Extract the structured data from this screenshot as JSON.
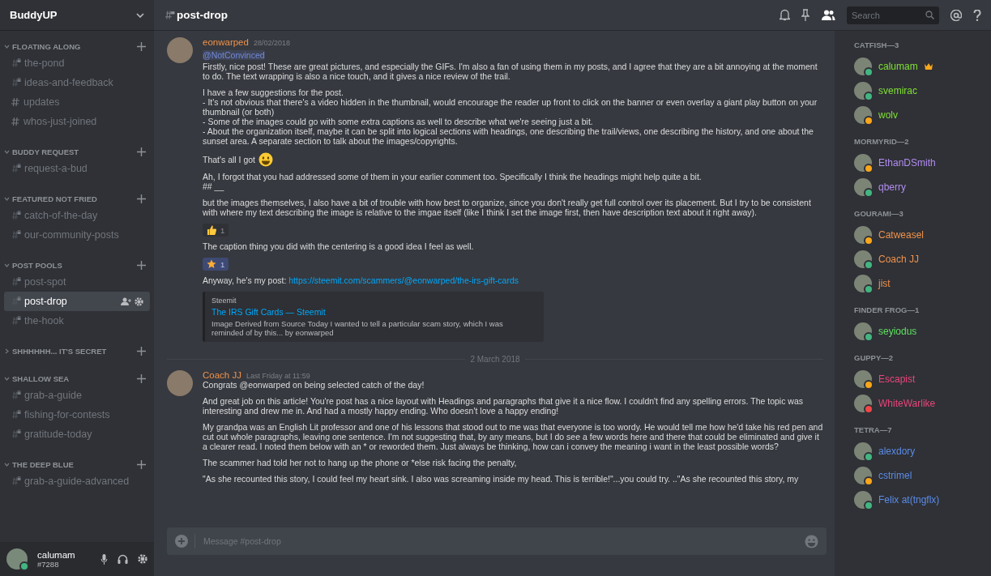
{
  "server": {
    "name": "BuddyUP"
  },
  "categories": [
    {
      "name": "FLOATING ALONG",
      "expanded": true,
      "channels": [
        {
          "name": "the-pond",
          "kind": "locked",
          "selected": false
        },
        {
          "name": "ideas-and-feedback",
          "kind": "locked",
          "selected": false
        },
        {
          "name": "updates",
          "kind": "public",
          "selected": false
        },
        {
          "name": "whos-just-joined",
          "kind": "public",
          "selected": false
        }
      ]
    },
    {
      "name": "BUDDY REQUEST",
      "expanded": true,
      "channels": [
        {
          "name": "request-a-bud",
          "kind": "locked",
          "selected": false
        }
      ]
    },
    {
      "name": "FEATURED NOT FRIED",
      "expanded": true,
      "channels": [
        {
          "name": "catch-of-the-day",
          "kind": "locked",
          "selected": false
        },
        {
          "name": "our-community-posts",
          "kind": "locked",
          "selected": false
        }
      ]
    },
    {
      "name": "POST POOLS",
      "expanded": true,
      "channels": [
        {
          "name": "post-spot",
          "kind": "locked",
          "selected": false
        },
        {
          "name": "post-drop",
          "kind": "locked",
          "selected": true
        },
        {
          "name": "the-hook",
          "kind": "locked",
          "selected": false
        }
      ]
    },
    {
      "name": "SHHHHHH... IT'S SECRET",
      "expanded": false
    },
    {
      "name": "SHALLOW SEA",
      "expanded": true,
      "channels": [
        {
          "name": "grab-a-guide",
          "kind": "locked",
          "selected": false
        },
        {
          "name": "fishing-for-contests",
          "kind": "locked",
          "selected": false
        },
        {
          "name": "gratitude-today",
          "kind": "locked",
          "selected": false
        }
      ]
    },
    {
      "name": "THE DEEP BLUE",
      "expanded": true,
      "channels": [
        {
          "name": "grab-a-guide-advanced",
          "kind": "locked",
          "selected": false
        }
      ]
    }
  ],
  "user": {
    "name": "calumam",
    "tag": "#7288"
  },
  "header": {
    "channel": "post-drop",
    "search": {
      "placeholder": "Search"
    }
  },
  "messages": [
    {
      "author": "eonwarped",
      "time": "28/02/2018",
      "blocks": [
        {
          "kind": "mention",
          "text": "@NotConvinced"
        },
        {
          "kind": "text",
          "text": "Firstly, nice post!  These are great pictures, and especially the GIFs. I'm also a fan of using them in my posts, and I agree that they are a bit annoying at the moment to do. The text wrapping is also a nice touch, and it gives a nice review of the trail."
        },
        {
          "kind": "text",
          "text": "I have a few suggestions for the post.\n- It's not obvious that there's a video hidden in the thumbnail, would encourage the reader up front to click on the banner or even overlay a giant play button on your thumbnail (or both)\n- Some of the images could go with some extra captions as well to describe what we're seeing just a bit.\n-  About the organization itself, maybe it can be split into logical sections with headings, one describing the trail/views,  one describing the history,  and one about the sunset area. A separate section to talk about the images/copyrights."
        },
        {
          "kind": "emoji_text",
          "text": "That's all I got"
        },
        {
          "kind": "text",
          "text": "Ah, I forgot that you had addressed some of them in your earlier comment too.  Specifically I think the headings might help quite a bit.\n## __"
        },
        {
          "kind": "text",
          "text": "but the images themselves, I also have a bit of trouble with how best to organize, since you don't really get full control over its placement. But I try to be consistent with where my text describing the image is relative to the imgae itself (like I think I set the image first, then have description text about it right away)."
        },
        {
          "kind": "reaction_thumbs",
          "count": "1",
          "selected": false
        },
        {
          "kind": "text",
          "text": "The caption thing you did with the centering is a good idea I feel as well."
        },
        {
          "kind": "reaction_star",
          "count": "1",
          "selected": true
        },
        {
          "kind": "link",
          "text": "Anyway, he's my post:",
          "url": "https://steemit.com/scammers/@eonwarped/the-irs-gift-cards"
        },
        {
          "kind": "embed",
          "provider": "Steemit",
          "title": "The IRS Gift Cards — Steemit",
          "text": "Image Derived from Source     Today I wanted to tell a particular scam story, which I was reminded of by this... by eonwarped"
        }
      ]
    },
    {
      "divider": "2 March 2018"
    },
    {
      "author": "Coach JJ",
      "time": "Last Friday at 11:59",
      "blocks": [
        {
          "kind": "text",
          "text": "Congrats @eonwarped on being selected catch of the day!"
        },
        {
          "kind": "text",
          "text": "And great job on this article! You're post has a nice layout with Headings and paragraphs that give it a nice flow. I couldn't find any spelling errors. The topic was interesting and drew me in. And had a mostly happy ending. Who doesn't love a happy ending!"
        },
        {
          "kind": "text",
          "text": "My grandpa was an English Lit professor and one of his lessons that stood out to me was that everyone is too wordy. He would tell me how he'd take his red pen and cut out whole paragraphs, leaving one sentence. I'm not suggesting that, by any means, but I do see a few words here and there that could be eliminated and give it a clearer read. I noted them below with an * or reworded them. Just always be thinking, how can i convey the meaning i want in the least possible words?"
        },
        {
          "kind": "text",
          "text": "The scammer had told her not to hang up the phone or *else risk facing the penalty,"
        },
        {
          "kind": "text",
          "text": "\"As she recounted this story, I could feel my heart sink. I also was screaming inside my head. This is terrible!\"...you could try. ..\"As she recounted this story, my"
        }
      ]
    }
  ],
  "composer": {
    "placeholder": "Message #post-drop"
  },
  "member_groups": [
    {
      "name": "CATFISH—3",
      "color": "#7fe032",
      "members": [
        {
          "name": "calumam",
          "owner": true,
          "color": "#43b581"
        },
        {
          "name": "svemirac",
          "owner": false,
          "color": "#43b581"
        },
        {
          "name": "wolv",
          "owner": false,
          "color": "#faa61a"
        }
      ]
    },
    {
      "name": "MORMYRID—2",
      "color": "#b28cf0",
      "members": [
        {
          "name": "EthanDSmith",
          "owner": false,
          "color": "#faa61a"
        },
        {
          "name": "qberry",
          "owner": false,
          "color": "#43b581"
        }
      ]
    },
    {
      "name": "GOURAMI—3",
      "color": "#f0924c",
      "members": [
        {
          "name": "Catweasel",
          "owner": false,
          "color": "#faa61a"
        },
        {
          "name": "Coach JJ",
          "owner": false,
          "color": "#43b581"
        },
        {
          "name": "jist",
          "owner": false,
          "color": "#43b581"
        }
      ]
    },
    {
      "name": "FINDER FROG—1",
      "color": "#5ee05e",
      "members": [
        {
          "name": "seyiodus",
          "owner": false,
          "color": "#43b581"
        }
      ]
    },
    {
      "name": "GUPPY—2",
      "color": "#e8467a",
      "members": [
        {
          "name": "Escapist",
          "owner": false,
          "color": "#faa61a"
        },
        {
          "name": "WhiteWarlike",
          "owner": false,
          "color": "#f04747"
        }
      ]
    },
    {
      "name": "TETRA—7",
      "color": "#5b8be8",
      "members": [
        {
          "name": "alexdory",
          "owner": false,
          "color": "#43b581"
        },
        {
          "name": "cstrimel",
          "owner": false,
          "color": "#faa61a"
        },
        {
          "name": "Felix at(tngflx)",
          "owner": false,
          "color": "#43b581"
        }
      ]
    }
  ]
}
